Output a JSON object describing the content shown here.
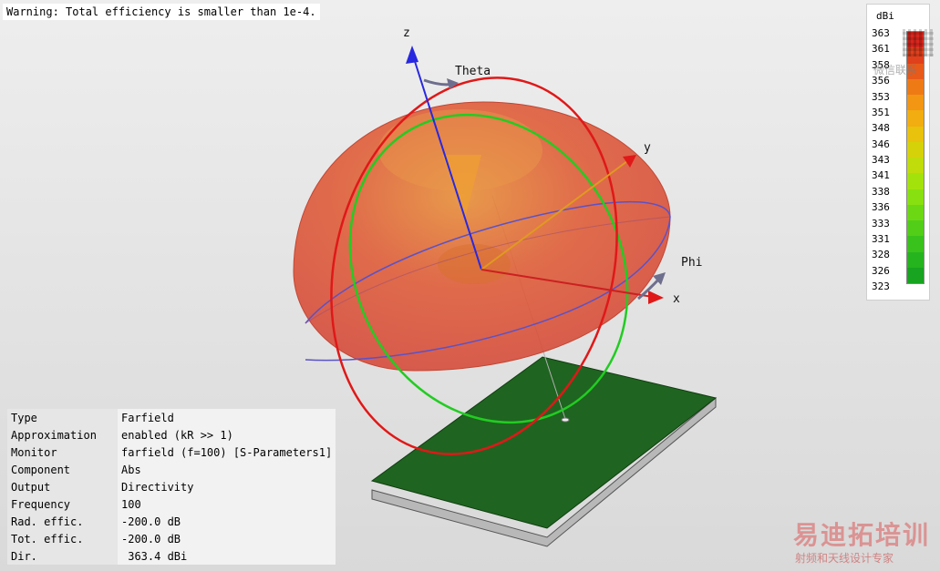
{
  "warning": "Warning: Total efficiency is smaller than 1e-4.",
  "axes": {
    "x": "x",
    "y": "y",
    "z": "z",
    "theta": "Theta",
    "phi": "Phi"
  },
  "info": [
    {
      "key": "Type",
      "value": "Farfield"
    },
    {
      "key": "Approximation",
      "value": "enabled (kR >> 1)"
    },
    {
      "key": "Monitor",
      "value": "farfield (f=100) [S-Parameters1]"
    },
    {
      "key": "Component",
      "value": "Abs"
    },
    {
      "key": "Output",
      "value": "Directivity"
    },
    {
      "key": "Frequency",
      "value": "100"
    },
    {
      "key": "Rad. effic.",
      "value": "-200.0 dB"
    },
    {
      "key": "Tot. effic.",
      "value": "-200.0 dB"
    },
    {
      "key": "Dir.",
      "value": " 363.4 dBi"
    }
  ],
  "legend": {
    "unit": "dBi",
    "ticks": [
      "363",
      "361",
      "358",
      "356",
      "353",
      "351",
      "348",
      "346",
      "343",
      "341",
      "338",
      "336",
      "333",
      "331",
      "328",
      "326",
      "323"
    ],
    "colors": [
      "#d9261c",
      "#e0401c",
      "#e85a1a",
      "#ee7a16",
      "#f29614",
      "#f2ad10",
      "#e8c20c",
      "#d6d20a",
      "#c0dc0a",
      "#a4e20c",
      "#88e010",
      "#6cd814",
      "#52ce18",
      "#3ac21c",
      "#26b41e",
      "#18a420"
    ]
  },
  "watermark": {
    "main": "易迪拓培训",
    "sub": "射频和天线设计专家",
    "qr_caption": "微信联系"
  }
}
